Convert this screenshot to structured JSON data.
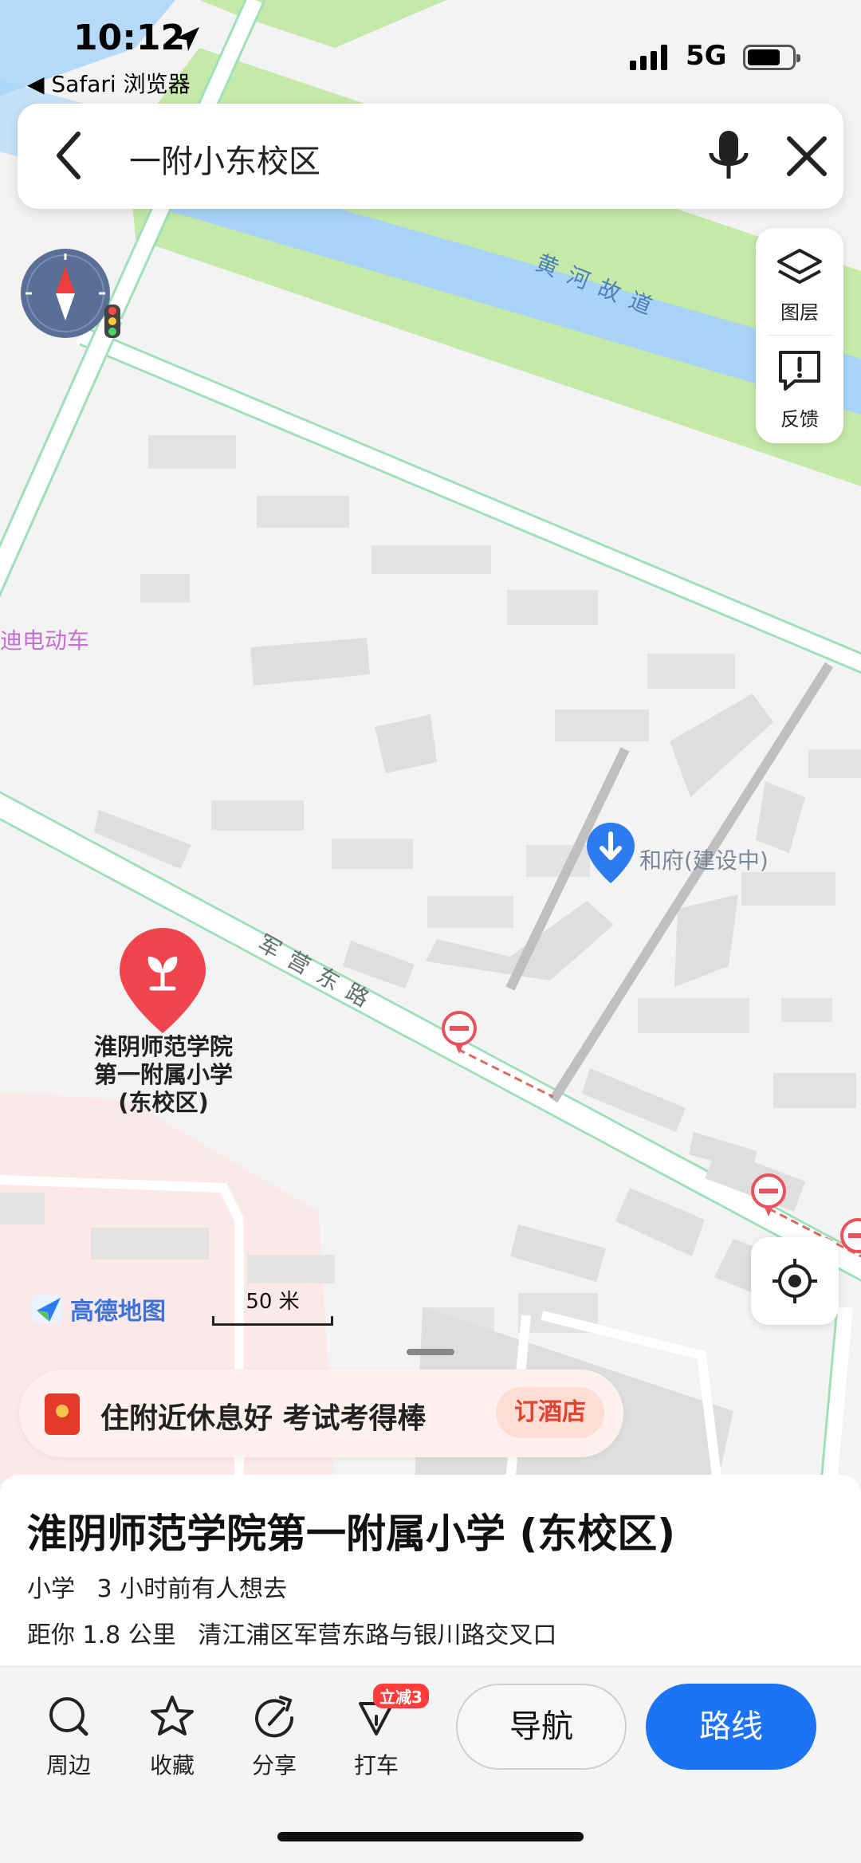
{
  "status_bar": {
    "time": "10:12",
    "back_app": "◀ Safari 浏览器",
    "network": "5G"
  },
  "search": {
    "query": "一附小东校区"
  },
  "layer_panel": {
    "layers_label": "图层",
    "feedback_label": "反馈"
  },
  "map": {
    "river_label": "黄河故道",
    "road_label": "军营东路",
    "shop_label": "迪电动车",
    "poi_label": "和府(建设中)",
    "school_pin_label": "淮阴师范学院\n第一附属小学\n(东校区)",
    "logo_text": "高德地图",
    "scale_text": "50 米"
  },
  "promo": {
    "text": "住附近休息好 考试考得棒",
    "cta": "订酒店"
  },
  "place": {
    "title": "淮阴师范学院第一附属小学 (东校区)",
    "category": "小学",
    "activity": "3 小时前有人想去",
    "distance": "距你 1.8 公里",
    "address": "清江浦区军营东路与银川路交叉口"
  },
  "actions": {
    "nearby": "周边",
    "favorite": "收藏",
    "share": "分享",
    "taxi": "打车",
    "taxi_badge": "立减3",
    "navigate": "导航",
    "route": "路线"
  },
  "colors": {
    "accent": "#1d73f5",
    "school_pin": "#f0444e",
    "river": "#a9d3f7",
    "park": "#c4e9a8",
    "road_edge": "#9ee0b8"
  }
}
